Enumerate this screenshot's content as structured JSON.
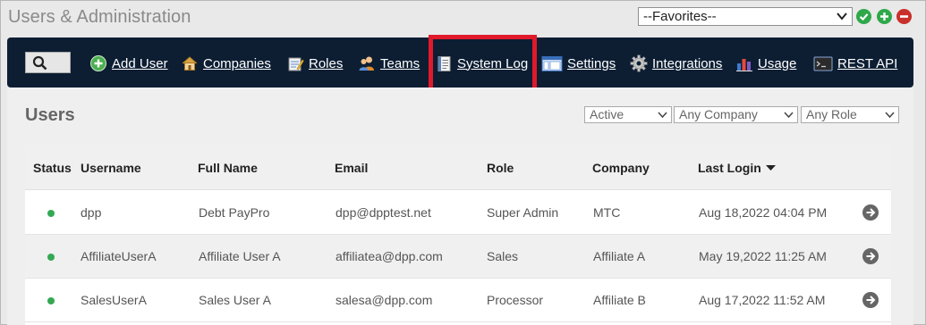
{
  "app": {
    "title": "Users & Administration"
  },
  "favorites": {
    "selected": "--Favorites--"
  },
  "nav": {
    "search_icon": "search-icon",
    "items": [
      {
        "label": "Add User",
        "icon": "add-user-icon"
      },
      {
        "label": "Companies",
        "icon": "home-icon"
      },
      {
        "label": "Roles",
        "icon": "roles-icon"
      },
      {
        "label": "Teams",
        "icon": "team-icon"
      },
      {
        "label": "System Log",
        "icon": "log-icon"
      },
      {
        "label": "Settings",
        "icon": "settings-icon"
      },
      {
        "label": "Integrations",
        "icon": "gear-icon"
      },
      {
        "label": "Usage",
        "icon": "chart-icon"
      },
      {
        "label": "REST API",
        "icon": "terminal-icon"
      }
    ]
  },
  "panel": {
    "title": "Users",
    "filters": {
      "status": "Active",
      "company": "Any Company",
      "role": "Any Role"
    }
  },
  "table": {
    "headers": {
      "status": "Status",
      "username": "Username",
      "full_name": "Full Name",
      "email": "Email",
      "role": "Role",
      "company": "Company",
      "last_login": "Last Login"
    },
    "rows": [
      {
        "username": "dpp",
        "full_name": "Debt PayPro",
        "email": "dpp@dpptest.net",
        "role": "Super Admin",
        "company": "MTC",
        "last_login": "Aug 18,2022 04:04 PM"
      },
      {
        "username": "AffiliateUserA",
        "full_name": "Affiliate User A",
        "email": "affiliatea@dpp.com",
        "role": "Sales",
        "company": "Affiliate A",
        "last_login": "May 19,2022 11:25 AM"
      },
      {
        "username": "SalesUserA",
        "full_name": "Sales User A",
        "email": "salesa@dpp.com",
        "role": "Processor",
        "company": "Affiliate B",
        "last_login": "Aug 17,2022 11:52 AM"
      }
    ]
  },
  "colors": {
    "navbar": "#0d1e33",
    "highlight": "#e0192b",
    "status_active": "#34a853",
    "action_green": "#2ea84a",
    "action_red": "#c9302c"
  }
}
